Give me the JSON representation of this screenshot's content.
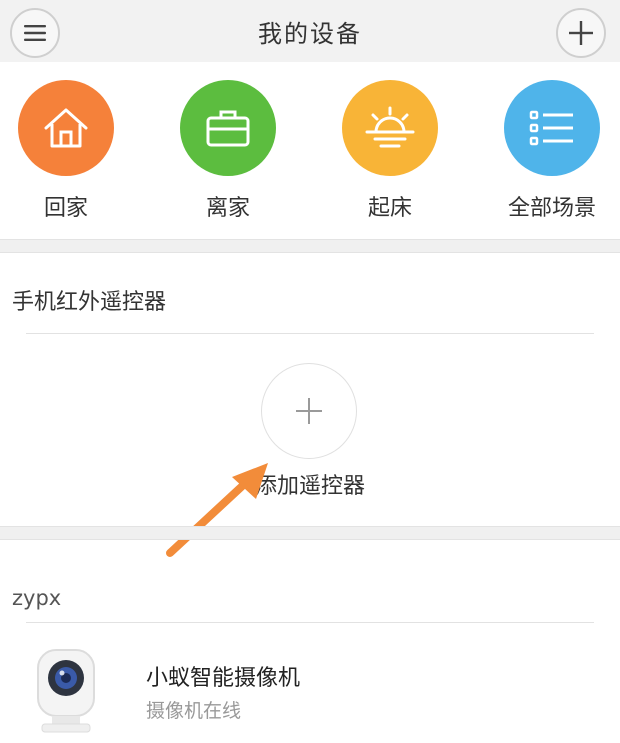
{
  "header": {
    "title": "我的设备"
  },
  "scenes": [
    {
      "label": "回家",
      "icon": "home-icon",
      "color": "#f5813a"
    },
    {
      "label": "离家",
      "icon": "briefcase-icon",
      "color": "#5cbd3f"
    },
    {
      "label": "起床",
      "icon": "sunrise-icon",
      "color": "#f8b437"
    },
    {
      "label": "全部场景",
      "icon": "list-icon",
      "color": "#4fb4ea"
    }
  ],
  "remote_section": {
    "title": "手机红外遥控器",
    "add_label": "添加遥控器"
  },
  "arrow_color": "#f28c3a",
  "device_group": {
    "title": "zypx",
    "devices": [
      {
        "name": "小蚁智能摄像机",
        "status": "摄像机在线",
        "icon": "camera-icon"
      }
    ]
  }
}
